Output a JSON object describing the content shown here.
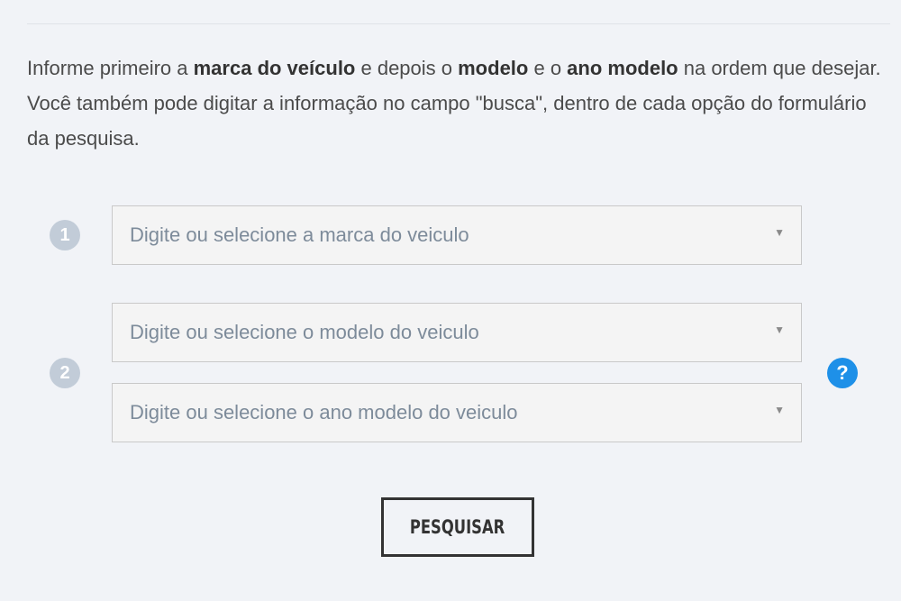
{
  "intro": {
    "p1": "Informe primeiro a ",
    "b1": "marca do veículo",
    "p2": " e depois o ",
    "b2": "modelo",
    "p3": " e o ",
    "b3": "ano modelo",
    "p4": " na ordem que desejar. Você também pode digitar a informação no campo \"busca\", dentro de cada opção do formulário da pesquisa."
  },
  "steps": [
    {
      "number": "1"
    },
    {
      "number": "2"
    }
  ],
  "selects": {
    "marca": {
      "placeholder": "Digite ou selecione a marca do veiculo",
      "caret": "▼"
    },
    "modelo": {
      "placeholder": "Digite ou selecione o modelo do veiculo",
      "caret": "▼"
    },
    "ano": {
      "placeholder": "Digite ou selecione o ano modelo do veiculo",
      "caret": "▼"
    }
  },
  "help": {
    "symbol": "?"
  },
  "search_button": {
    "label": "PESQUISAR"
  },
  "colors": {
    "background": "#f1f3f7",
    "badge": "#c2ccd8",
    "help": "#1e90e8",
    "placeholder": "#7d8b9a"
  }
}
